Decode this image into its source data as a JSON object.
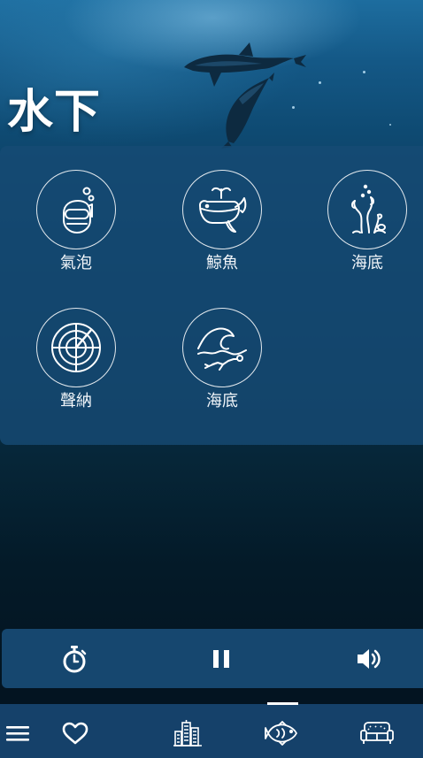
{
  "header": {
    "title": "水下"
  },
  "sounds": [
    {
      "label": "氣泡",
      "icon": "diver-bubbles-icon"
    },
    {
      "label": "鯨魚",
      "icon": "whale-icon"
    },
    {
      "label": "海底",
      "icon": "seaweed-icon"
    },
    {
      "label": "聲納",
      "icon": "sonar-icon"
    },
    {
      "label": "海底",
      "icon": "wave-diver-icon"
    }
  ],
  "player": {
    "controls": [
      "timer-icon",
      "pause-icon",
      "volume-icon"
    ]
  },
  "bottom_nav": {
    "items": [
      "menu-icon",
      "heart-icon",
      "city-icon",
      "fish-icon",
      "sofa-icon"
    ],
    "active": "fish-icon"
  },
  "colors": {
    "panel": "#164a74",
    "player": "#16476f",
    "navbar": "#15416a",
    "text": "#ffffff"
  }
}
